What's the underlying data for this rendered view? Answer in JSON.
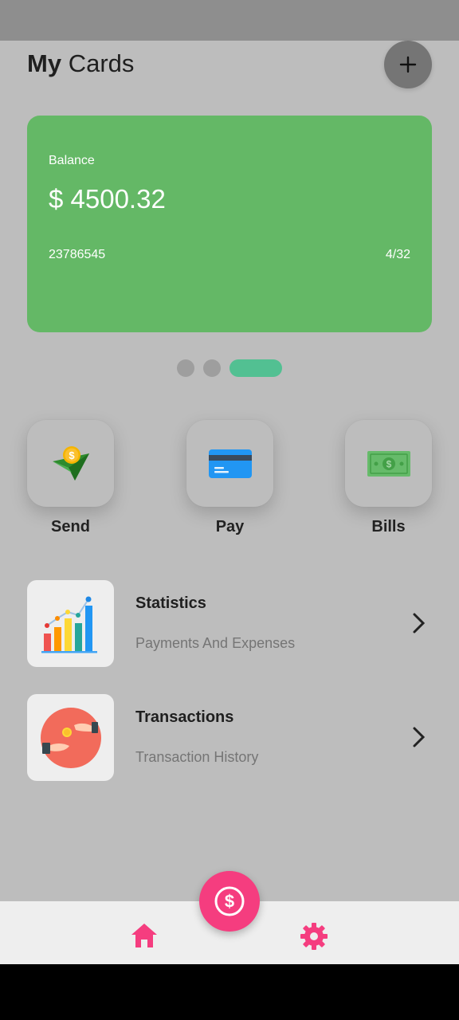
{
  "header": {
    "title_bold": "My",
    "title_light": "Cards",
    "add_icon": "plus-icon"
  },
  "card": {
    "balance_label": "Balance",
    "balance_amount": "$ 4500.32",
    "card_number": "23786545",
    "expiry": "4/32",
    "color": "#64b866"
  },
  "carousel": {
    "count": 3,
    "active_index": 2,
    "active_color": "#52c092"
  },
  "actions": [
    {
      "label": "Send",
      "icon": "send-money-icon"
    },
    {
      "label": "Pay",
      "icon": "credit-card-icon"
    },
    {
      "label": "Bills",
      "icon": "banknote-icon"
    }
  ],
  "menu": [
    {
      "title": "Statistics",
      "subtitle": "Payments And Expenses",
      "icon": "statistics-chart-icon"
    },
    {
      "title": "Transactions",
      "subtitle": "Transaction History",
      "icon": "transaction-hands-icon"
    }
  ],
  "bottom_nav": {
    "home_icon": "home-icon",
    "settings_icon": "gear-icon",
    "fab_icon": "dollar-icon",
    "accent": "#f53d7f"
  }
}
